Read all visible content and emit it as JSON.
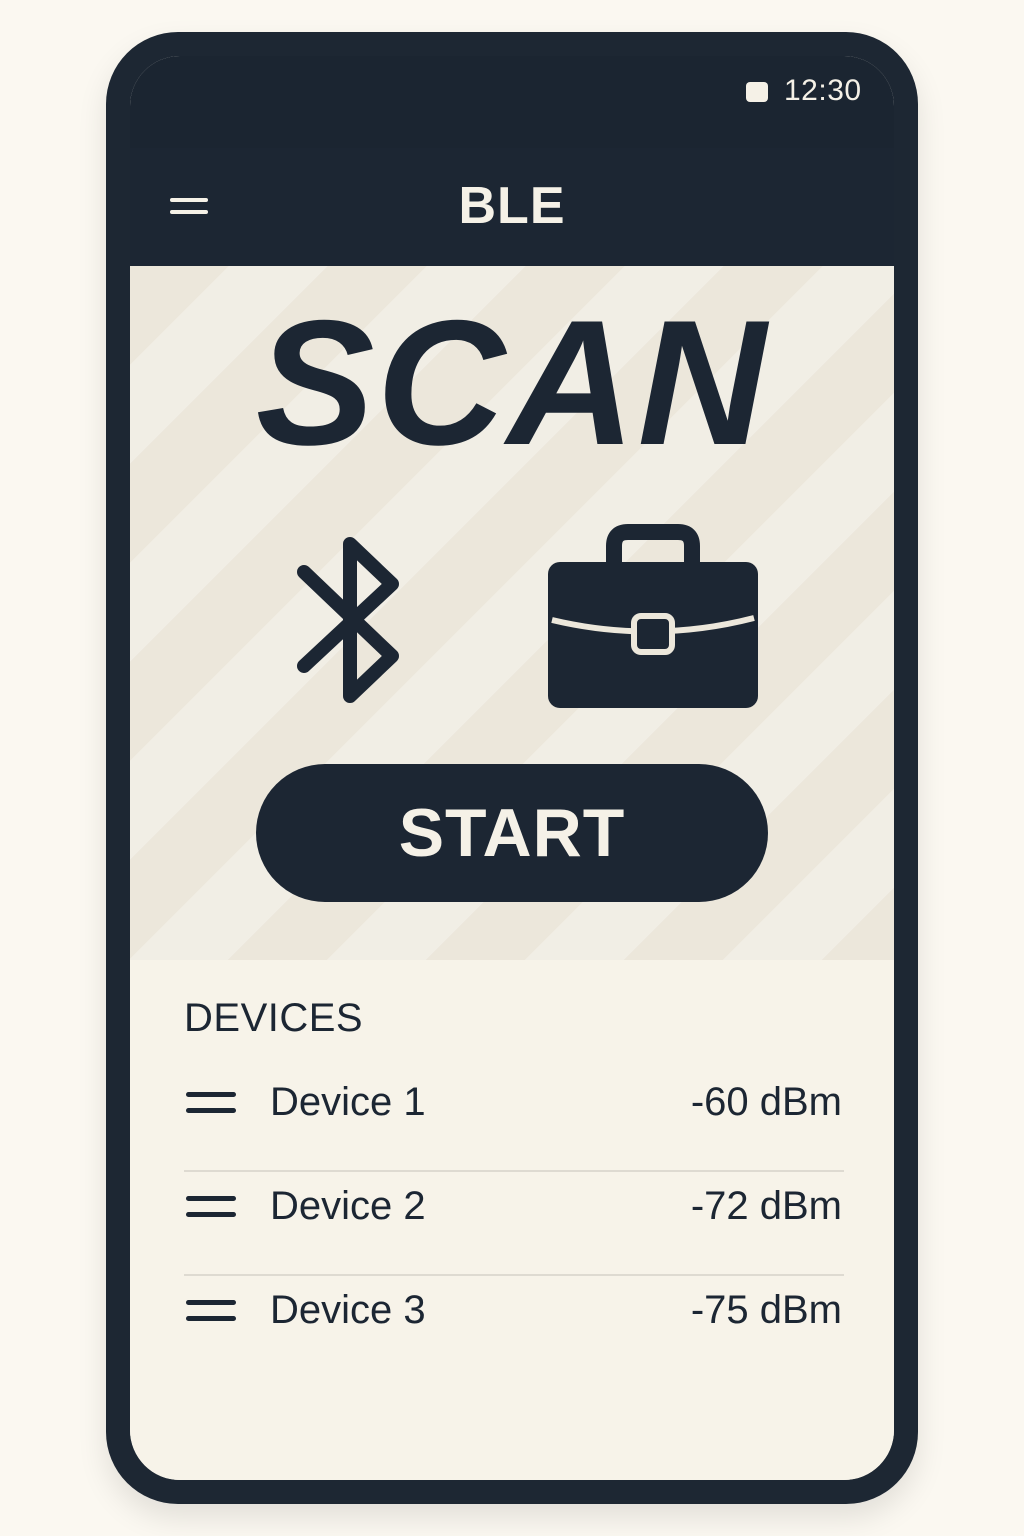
{
  "status_bar": {
    "time": "12:30"
  },
  "app_bar": {
    "title": "BLE"
  },
  "hero": {
    "title": "SCAN",
    "start_label": "START"
  },
  "devices": {
    "heading": "DEVICES",
    "items": [
      {
        "name": "Device 1",
        "signal": "-60 dBm"
      },
      {
        "name": "Device 2",
        "signal": "-72 dBm"
      },
      {
        "name": "Device 3",
        "signal": "-75 dBm"
      }
    ]
  },
  "icons": {
    "menu": "menu-icon",
    "bluetooth": "bluetooth-icon",
    "briefcase": "briefcase-icon",
    "battery": "battery-icon",
    "device_row": "list-icon"
  },
  "colors": {
    "dark": "#1c2633",
    "background": "#fbf8f1",
    "screen": "#f5f1e7",
    "hero": "#ece7db"
  }
}
